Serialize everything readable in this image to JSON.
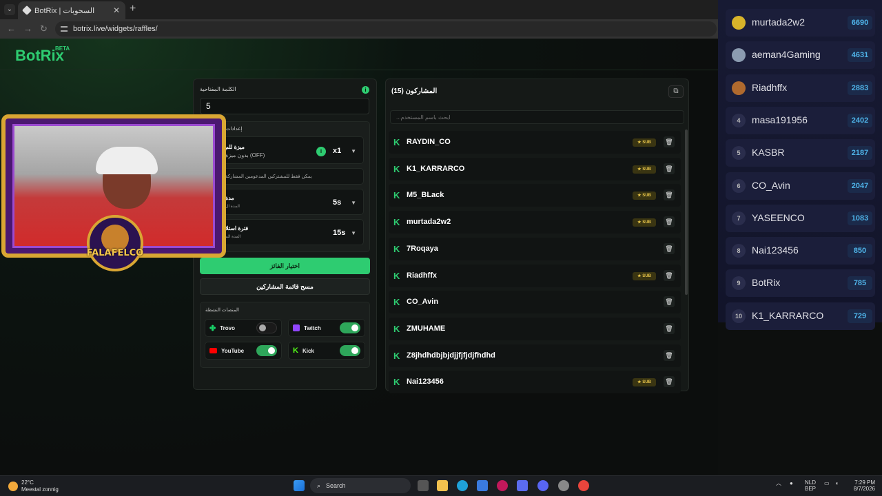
{
  "browser": {
    "tab_title": "BotRix | السحوبات",
    "url": "botrix.live/widgets/raffles/"
  },
  "app": {
    "logo": "BotRix",
    "beta": "BETA"
  },
  "settings": {
    "keyword_label": "الكلمة المفتاحية",
    "keyword_value": "5",
    "section_label": "إعدادات",
    "rows": [
      {
        "title": "ميزة للم",
        "sub": "بدون ميزة (OFF)",
        "value": "x1"
      },
      {
        "note": "يمكن فقط للمشتركين المدعومين المشاركة"
      },
      {
        "title": "مدة",
        "sub": "المدة ال",
        "value": "5s"
      },
      {
        "title": "فترة استلا",
        "sub": "المدة الم",
        "value": "15s"
      }
    ],
    "pick_winner": "اختيار الفائز",
    "clear_list": "مسح قائمة المشاركين",
    "platforms_label": "المنصات النشطة",
    "platforms": [
      {
        "name": "Trovo",
        "on": false,
        "color": "#19d66b"
      },
      {
        "name": "Twitch",
        "on": true,
        "color": "#9146ff"
      },
      {
        "name": "YouTube",
        "on": true,
        "color": "#ff0000"
      },
      {
        "name": "Kick",
        "on": true,
        "color": "#53fc18"
      }
    ]
  },
  "participants": {
    "title": "المشاركون (15)",
    "search_placeholder": "...ابحث باسم المستخدم",
    "sub_label": "SUB",
    "list": [
      {
        "name": "RAYDIN_CO",
        "sub": true
      },
      {
        "name": "K1_KARRARCO",
        "sub": true
      },
      {
        "name": "M5_BLack",
        "sub": true
      },
      {
        "name": "murtada2w2",
        "sub": true
      },
      {
        "name": "7Roqaya",
        "sub": false
      },
      {
        "name": "Riadhffx",
        "sub": true
      },
      {
        "name": "CO_Avin",
        "sub": false
      },
      {
        "name": "ZMUHAME",
        "sub": false
      },
      {
        "name": "Z8jhdhdbjbjdjjfjfjdjfhdhd",
        "sub": false
      },
      {
        "name": "Nai123456",
        "sub": true
      }
    ]
  },
  "leaderboard": [
    {
      "rank": "",
      "name": "murtada2w2",
      "points": "6690",
      "color": "#d8b42a"
    },
    {
      "rank": "",
      "name": "aeman4Gaming",
      "points": "4631",
      "color": "#8b9bb0"
    },
    {
      "rank": "",
      "name": "Riadhffx",
      "points": "2883",
      "color": "#b06a2e"
    },
    {
      "rank": "4",
      "name": "masa191956",
      "points": "2402"
    },
    {
      "rank": "5",
      "name": "KASBR",
      "points": "2187"
    },
    {
      "rank": "6",
      "name": "CO_Avin",
      "points": "2047"
    },
    {
      "rank": "7",
      "name": "YASEENCO",
      "points": "1083"
    },
    {
      "rank": "8",
      "name": "Nai123456",
      "points": "850"
    },
    {
      "rank": "9",
      "name": "BotRix",
      "points": "785"
    },
    {
      "rank": "10",
      "name": "K1_KARRARCO",
      "points": "729"
    }
  ],
  "webcam": {
    "overlay_text": "FALAFELCO"
  },
  "taskbar": {
    "temp": "22°C",
    "weather": "Meestal zonnig",
    "search": "Search",
    "lang1": "NLD",
    "lang2": "BEP",
    "time": "7:29 PM",
    "date": "8/7/2026"
  }
}
